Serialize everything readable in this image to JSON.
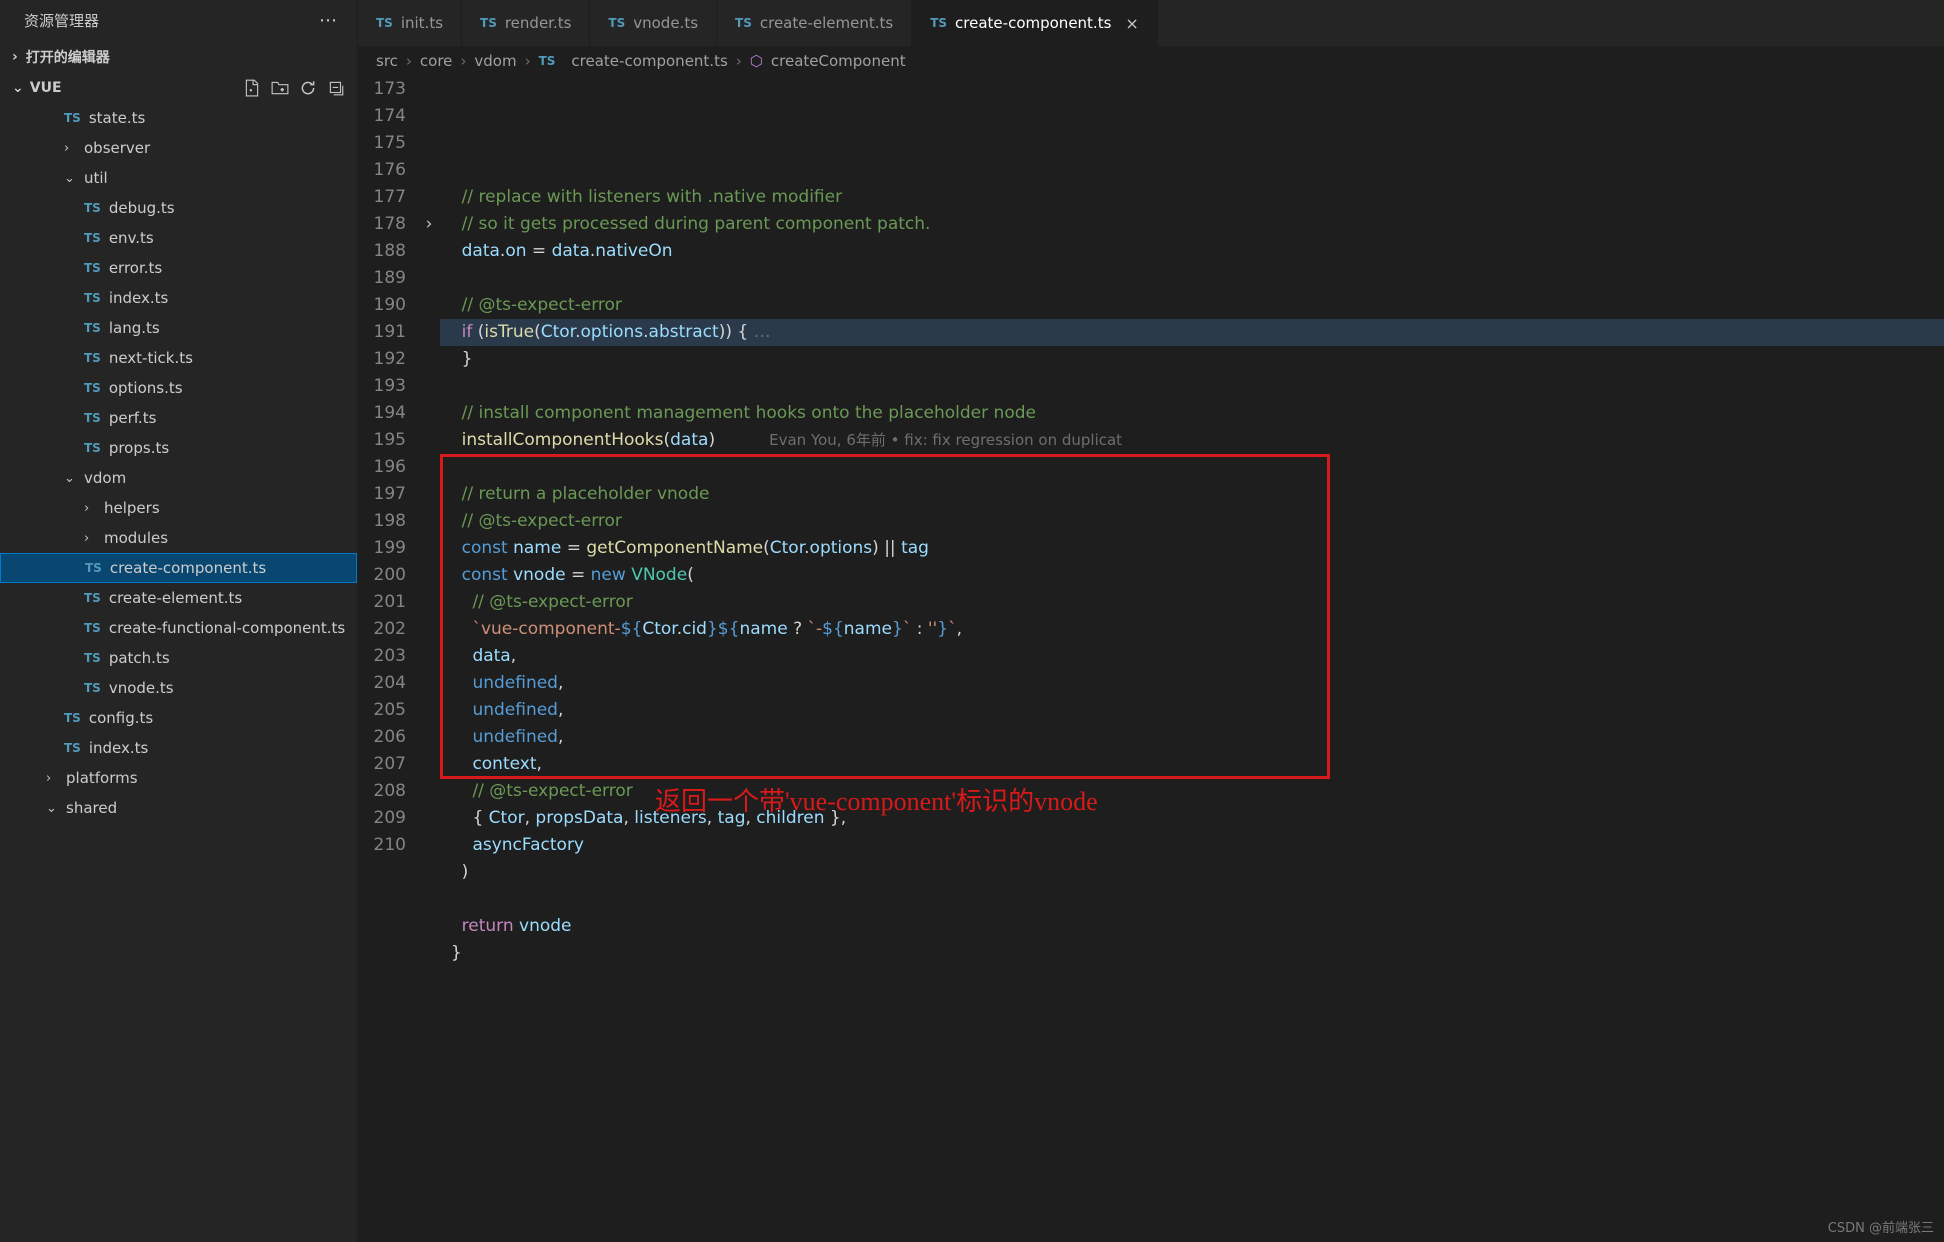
{
  "sidebar": {
    "title": "资源管理器",
    "openEditors": "打开的编辑器",
    "project": "VUE",
    "tree": [
      {
        "type": "file",
        "label": "state.ts",
        "indent": 2,
        "icon": "ts"
      },
      {
        "type": "folder",
        "label": "observer",
        "indent": 2,
        "state": "closed"
      },
      {
        "type": "folder",
        "label": "util",
        "indent": 2,
        "state": "open"
      },
      {
        "type": "file",
        "label": "debug.ts",
        "indent": 3,
        "icon": "ts"
      },
      {
        "type": "file",
        "label": "env.ts",
        "indent": 3,
        "icon": "ts"
      },
      {
        "type": "file",
        "label": "error.ts",
        "indent": 3,
        "icon": "ts"
      },
      {
        "type": "file",
        "label": "index.ts",
        "indent": 3,
        "icon": "ts"
      },
      {
        "type": "file",
        "label": "lang.ts",
        "indent": 3,
        "icon": "ts"
      },
      {
        "type": "file",
        "label": "next-tick.ts",
        "indent": 3,
        "icon": "ts"
      },
      {
        "type": "file",
        "label": "options.ts",
        "indent": 3,
        "icon": "ts"
      },
      {
        "type": "file",
        "label": "perf.ts",
        "indent": 3,
        "icon": "ts"
      },
      {
        "type": "file",
        "label": "props.ts",
        "indent": 3,
        "icon": "ts"
      },
      {
        "type": "folder",
        "label": "vdom",
        "indent": 2,
        "state": "open"
      },
      {
        "type": "folder",
        "label": "helpers",
        "indent": 3,
        "state": "closed"
      },
      {
        "type": "folder",
        "label": "modules",
        "indent": 3,
        "state": "closed"
      },
      {
        "type": "file",
        "label": "create-component.ts",
        "indent": 3,
        "icon": "ts",
        "selected": true
      },
      {
        "type": "file",
        "label": "create-element.ts",
        "indent": 3,
        "icon": "ts"
      },
      {
        "type": "file",
        "label": "create-functional-component.ts",
        "indent": 3,
        "icon": "ts"
      },
      {
        "type": "file",
        "label": "patch.ts",
        "indent": 3,
        "icon": "ts"
      },
      {
        "type": "file",
        "label": "vnode.ts",
        "indent": 3,
        "icon": "ts"
      },
      {
        "type": "file",
        "label": "config.ts",
        "indent": 2,
        "icon": "ts"
      },
      {
        "type": "file",
        "label": "index.ts",
        "indent": 2,
        "icon": "ts"
      },
      {
        "type": "folder",
        "label": "platforms",
        "indent": 1,
        "state": "closed"
      },
      {
        "type": "folder",
        "label": "shared",
        "indent": 1,
        "state": "open"
      }
    ]
  },
  "tabs": [
    {
      "label": "init.ts"
    },
    {
      "label": "render.ts"
    },
    {
      "label": "vnode.ts"
    },
    {
      "label": "create-element.ts"
    },
    {
      "label": "create-component.ts",
      "active": true
    }
  ],
  "breadcrumbs": {
    "parts": [
      "src",
      "core",
      "vdom"
    ],
    "file": "create-component.ts",
    "symbol": "createComponent"
  },
  "code": {
    "start": 173,
    "lines": [
      {
        "n": 173,
        "html": "    <span class='cm'>// replace with listeners with .native modifier</span>"
      },
      {
        "n": 174,
        "html": "    <span class='cm'>// so it gets processed during parent component patch.</span>"
      },
      {
        "n": 175,
        "html": "    <span class='vr'>data</span><span class='pn'>.</span><span class='pr'>on</span> <span class='pn'>=</span> <span class='vr'>data</span><span class='pn'>.</span><span class='pr'>nativeOn</span>"
      },
      {
        "n": 176,
        "html": ""
      },
      {
        "n": 177,
        "html": "    <span class='cm'>// @ts-expect-error</span>"
      },
      {
        "n": 178,
        "html": "    <span class='kw2'>if</span> <span class='pn'>(</span><span class='fn'>isTrue</span><span class='pn'>(</span><span class='vr'>Ctor</span><span class='pn'>.</span><span class='pr'>options</span><span class='pn'>.</span><span class='pr'>abstract</span><span class='pn'>)) {</span><span class='dim'> …</span>",
        "fold": true,
        "hl": true
      },
      {
        "n": 188,
        "html": "    <span class='pn'>}</span>"
      },
      {
        "n": 189,
        "html": ""
      },
      {
        "n": 190,
        "html": "    <span class='cm'>// install component management hooks onto the placeholder node</span>"
      },
      {
        "n": 191,
        "html": "    <span class='fn'>installComponentHooks</span><span class='pn'>(</span><span class='vr'>data</span><span class='pn'>)</span>          <span class='blame'>Evan You, 6年前 • fix: fix regression on duplicat</span>"
      },
      {
        "n": 192,
        "html": ""
      },
      {
        "n": 193,
        "html": "    <span class='cm'>// return a placeholder vnode</span>"
      },
      {
        "n": 194,
        "html": "    <span class='cm'>// @ts-expect-error</span>"
      },
      {
        "n": 195,
        "html": "    <span class='kw'>const</span> <span class='vr'>name</span> <span class='pn'>=</span> <span class='fn'>getComponentName</span><span class='pn'>(</span><span class='vr'>Ctor</span><span class='pn'>.</span><span class='pr'>options</span><span class='pn'>) ||</span> <span class='vr'>tag</span>"
      },
      {
        "n": 196,
        "html": "    <span class='kw'>const</span> <span class='vr'>vnode</span> <span class='pn'>=</span> <span class='kw'>new</span> <span class='cl'>VNode</span><span class='pn'>(</span>"
      },
      {
        "n": 197,
        "html": "      <span class='cm'>// @ts-expect-error</span>"
      },
      {
        "n": 198,
        "html": "      <span class='st'>`vue-component-</span><span class='kw'>${</span><span class='vr'>Ctor</span><span class='pn'>.</span><span class='pr'>cid</span><span class='kw'>}${</span><span class='vr'>name</span> <span class='pn'>?</span> <span class='st'>`-</span><span class='kw'>${</span><span class='vr'>name</span><span class='kw'>}</span><span class='st'>`</span> <span class='pn'>:</span> <span class='st'>''</span><span class='kw'>}</span><span class='st'>`</span><span class='pn'>,</span>"
      },
      {
        "n": 199,
        "html": "      <span class='vr'>data</span><span class='pn'>,</span>"
      },
      {
        "n": 200,
        "html": "      <span class='kw'>undefined</span><span class='pn'>,</span>"
      },
      {
        "n": 201,
        "html": "      <span class='kw'>undefined</span><span class='pn'>,</span>"
      },
      {
        "n": 202,
        "html": "      <span class='kw'>undefined</span><span class='pn'>,</span>"
      },
      {
        "n": 203,
        "html": "      <span class='vr'>context</span><span class='pn'>,</span>"
      },
      {
        "n": 204,
        "html": "      <span class='cm'>// @ts-expect-error</span>"
      },
      {
        "n": 205,
        "html": "      <span class='pn'>{</span> <span class='vr'>Ctor</span><span class='pn'>,</span> <span class='vr'>propsData</span><span class='pn'>,</span> <span class='vr'>listeners</span><span class='pn'>,</span> <span class='vr'>tag</span><span class='pn'>,</span> <span class='vr'>children</span> <span class='pn'>},</span>"
      },
      {
        "n": 206,
        "html": "      <span class='vr'>asyncFactory</span>"
      },
      {
        "n": 207,
        "html": "    <span class='pn'>)</span>"
      },
      {
        "n": 208,
        "html": ""
      },
      {
        "n": 209,
        "html": "    <span class='kw2'>return</span> <span class='vr'>vnode</span>"
      },
      {
        "n": 210,
        "html": "  <span class='pn'>}</span>"
      }
    ]
  },
  "annotation": "返回一个带'vue-component'标识的vnode",
  "watermark": "CSDN @前端张三"
}
